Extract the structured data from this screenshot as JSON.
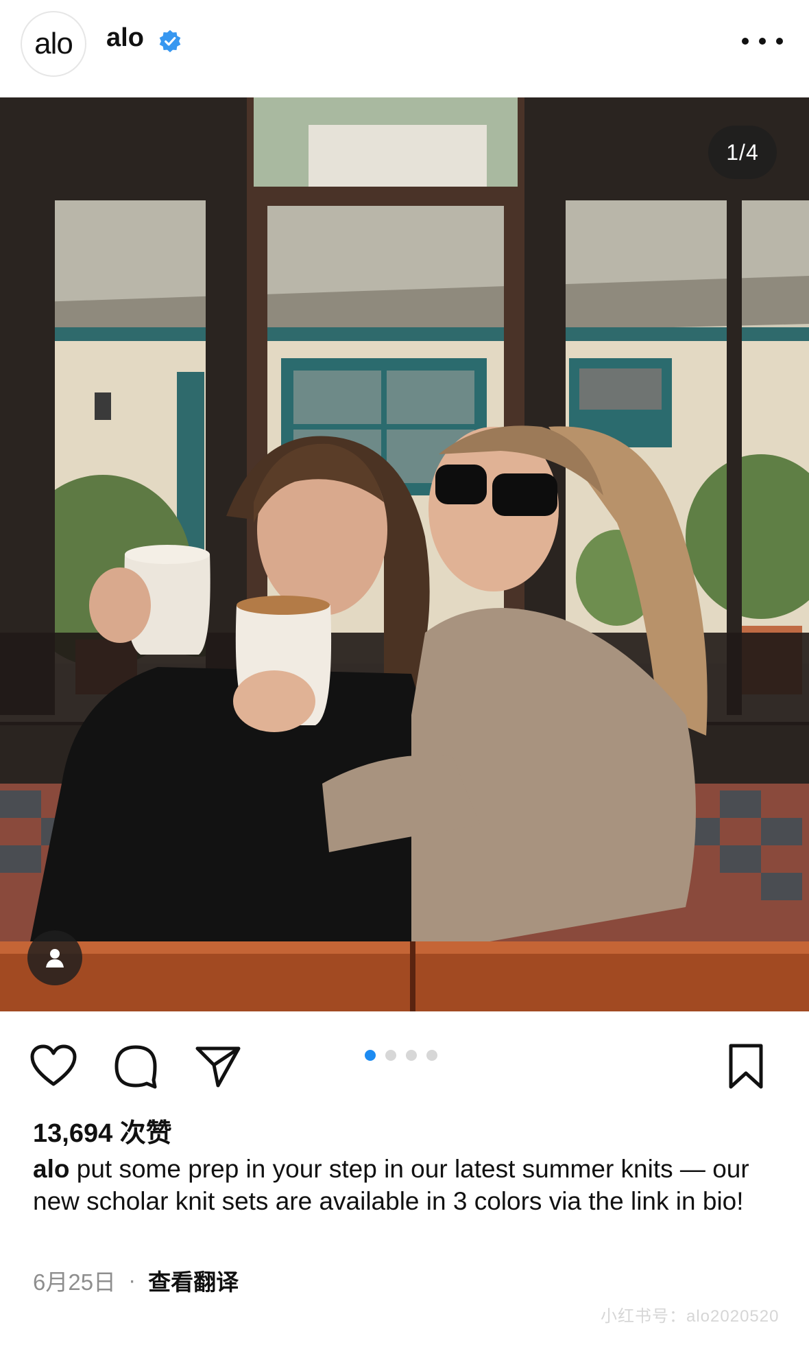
{
  "account": {
    "avatar_text": "alo",
    "username": "alo",
    "verified": true
  },
  "post": {
    "image_counter": "1/4",
    "current_image": 1,
    "total_images": 4,
    "likes": "13,694 次赞",
    "caption_username": "alo",
    "caption_text": "put some prep in your step in our latest summer knits — our new scholar knit sets are available in 3 colors via the link in bio!",
    "date": "6月25日",
    "separator": "·",
    "translate_label": "查看翻译"
  },
  "icons": {
    "more": "more-icon",
    "like": "heart-icon",
    "comment": "comment-icon",
    "share": "send-icon",
    "save": "bookmark-icon",
    "tag": "person-tag-icon",
    "verified": "verified-badge-icon"
  },
  "colors": {
    "accent": "#1d8bf1",
    "verified_badge": "#3797f0",
    "text_primary": "#111111",
    "text_secondary": "#8e8e8e"
  },
  "watermark": "小红书号：alo2020520"
}
